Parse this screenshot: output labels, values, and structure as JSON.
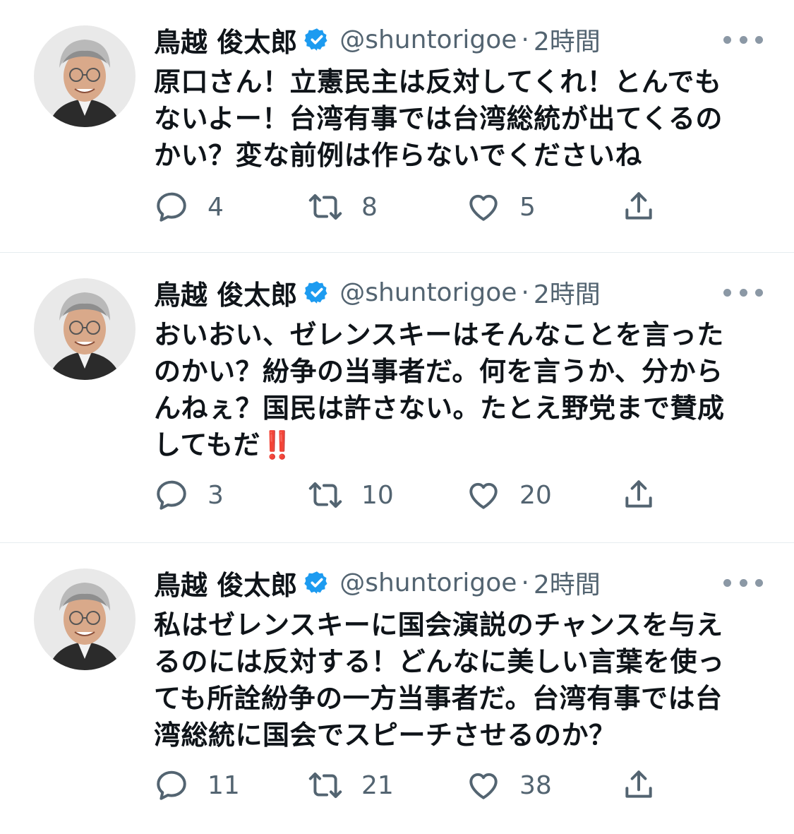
{
  "tweets": [
    {
      "author_name": "鳥越 俊太郎",
      "handle": "@shuntorigoe",
      "separator": "·",
      "time": "2時間",
      "text": "原口さん！立憲民主は反対してくれ！とんでもないよー！台湾有事では台湾総統が出てくるのかい？変な前例は作らないでくださいね",
      "emoji": "",
      "reply_count": "4",
      "retweet_count": "8",
      "like_count": "5"
    },
    {
      "author_name": "鳥越 俊太郎",
      "handle": "@shuntorigoe",
      "separator": "·",
      "time": "2時間",
      "text": "おいおい、ゼレンスキーはそんなことを言ったのかい？紛争の当事者だ。何を言うか、分からんねぇ？国民は許さない。たとえ野党まで賛成してもだ",
      "emoji": "‼️",
      "reply_count": "3",
      "retweet_count": "10",
      "like_count": "20"
    },
    {
      "author_name": "鳥越 俊太郎",
      "handle": "@shuntorigoe",
      "separator": "·",
      "time": "2時間",
      "text": "私はゼレンスキーに国会演説のチャンスを与えるのには反対する！どんなに美しい言葉を使っても所詮紛争の一方当事者だ。台湾有事では台湾総統に国会でスピーチさせるのか？",
      "emoji": "",
      "reply_count": "11",
      "retweet_count": "21",
      "like_count": "38"
    }
  ],
  "icons": {
    "verified": "verified-badge-icon",
    "more": "more-options-icon",
    "reply": "reply-icon",
    "retweet": "retweet-icon",
    "like": "heart-icon",
    "share": "share-icon"
  },
  "colors": {
    "verified_blue": "#1d9bf0",
    "secondary_text": "#536471",
    "primary_text": "#0f1419",
    "divider": "#e6ecf0",
    "emoji_red": "#d0021b"
  }
}
